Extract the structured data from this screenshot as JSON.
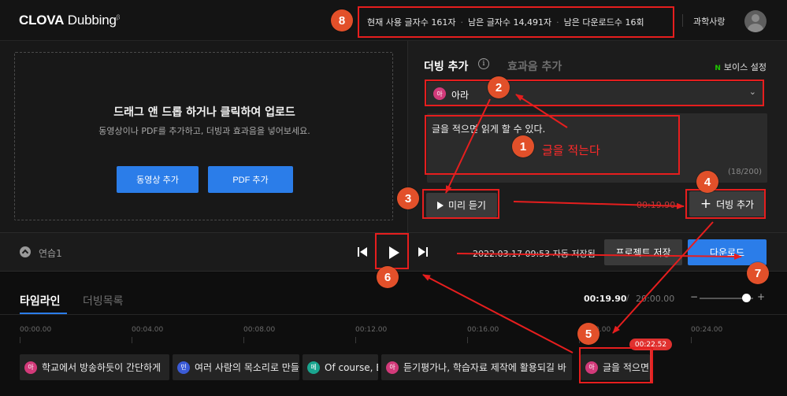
{
  "header": {
    "logo_main": "CLOVA",
    "logo_sub": "Dubbing",
    "logo_beta": "β",
    "usage": [
      "현재 사용 글자수 161자",
      "남은 글자수 14,491자",
      "남은 다운로드수 16회"
    ],
    "user_name": "과학사랑"
  },
  "upload": {
    "title": "드래그 앤 드롭 하거나 클릭하여 업로드",
    "description": "동영상이나 PDF를 추가하고, 더빙과 효과음을 넣어보세요.",
    "add_video": "동영상 추가",
    "add_pdf": "PDF 추가"
  },
  "dubbing": {
    "tab_dub": "더빙 추가",
    "info_icon": "i",
    "tab_sfx": "효과음 추가",
    "voice_setting_icon": "N",
    "voice_setting": "보이스 설정",
    "voice_badge": "아",
    "voice_name": "아라",
    "text_value": "글을 적으면 읽게 할 수 있다.",
    "char_count": "(18/200)",
    "preview": "미리 듣기",
    "duration": "00:19.90",
    "add_dub_plus": "+",
    "add_dub": "더빙 추가"
  },
  "controls": {
    "project_name": "연습1",
    "autosave": "2022.03.17 09:53 자동 저장됨",
    "save_project": "프로젝트 저장",
    "download": "다운로드"
  },
  "timeline": {
    "tab_timeline": "타임라인",
    "tab_list": "더빙목록",
    "current_time": "00:19.90",
    "separator": "/",
    "total_time": "20:00.00",
    "zoom_minus": "−",
    "zoom_plus": "+",
    "ticks": [
      "00:00.00",
      "00:04.00",
      "00:08.00",
      "00:12.00",
      "00:16.00",
      "00:20.00",
      "00:24.00"
    ],
    "playhead": "00:22.52",
    "clips": [
      {
        "badge": "아",
        "badge_color": "#d23a7a",
        "text": "학교에서 방송하듯이 간단하게"
      },
      {
        "badge": "민",
        "badge_color": "#3b5bd6",
        "text": "여러 사람의 목소리로 만들"
      },
      {
        "badge": "메",
        "badge_color": "#1aa58f",
        "text": "Of course, E"
      },
      {
        "badge": "아",
        "badge_color": "#d23a7a",
        "text": "듣기평가나, 학습자료 제작에 활용되길 바"
      },
      {
        "badge": "아",
        "badge_color": "#d23a7a",
        "text": "글을 적으면"
      }
    ]
  },
  "annotations": {
    "numbers": [
      "1",
      "2",
      "3",
      "4",
      "5",
      "6",
      "7",
      "8"
    ],
    "note": "글을 적는다"
  }
}
